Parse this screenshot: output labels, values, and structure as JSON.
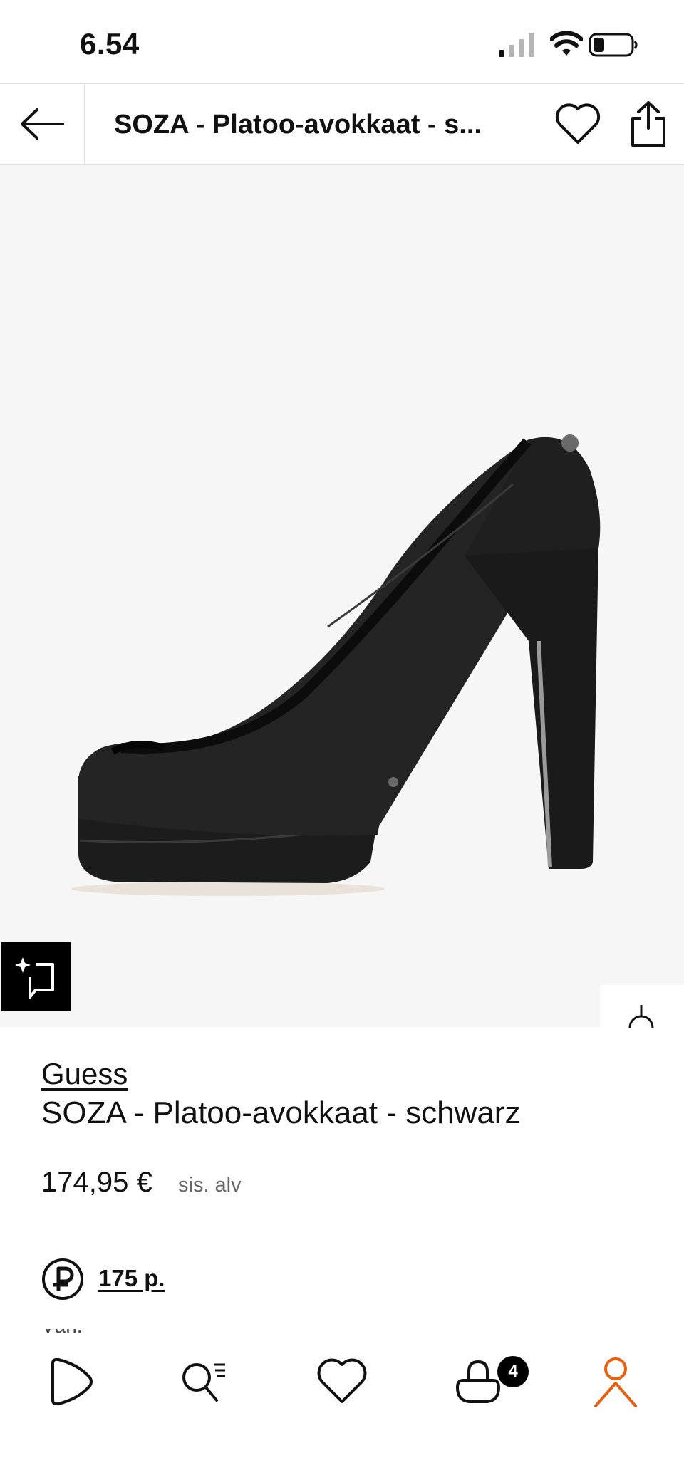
{
  "status_bar": {
    "time": "6.54"
  },
  "header": {
    "title": "SOZA - Platoo-avokkaat - s..."
  },
  "product": {
    "brand": "Guess",
    "name": "SOZA - Platoo-avokkaat - schwarz",
    "price": "174,95 €",
    "vat_note": "sis. alv",
    "points": "175 p.",
    "cut_off_text": "Väri: Schwarz"
  },
  "tab_bar": {
    "cart_count": "4"
  },
  "colors": {
    "accent": "#e8600f",
    "text": "#111111",
    "muted": "#666666",
    "image_bg": "#f6f6f6"
  },
  "icons": [
    "back-arrow-icon",
    "heart-icon",
    "share-icon",
    "ai-search-icon",
    "play-icon",
    "search-list-icon",
    "bag-icon",
    "profile-icon",
    "points-icon"
  ]
}
